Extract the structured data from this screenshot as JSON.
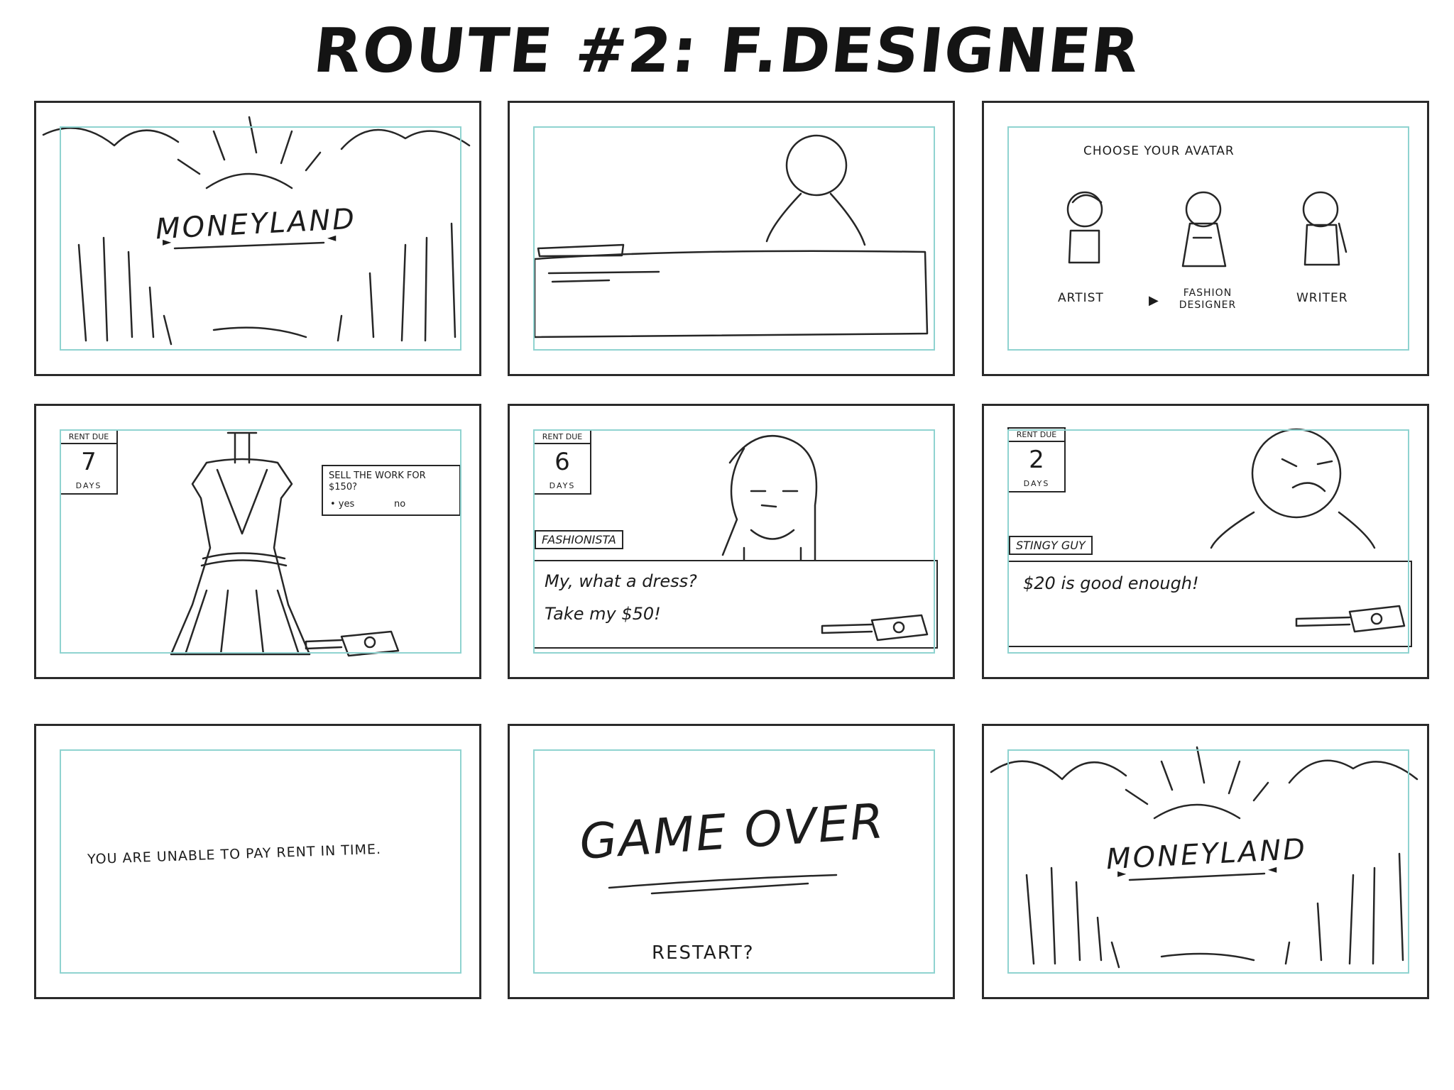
{
  "title": "ROUTE #2: F.DESIGNER",
  "panels": {
    "p1": {
      "logo": "MONEYLAND"
    },
    "p3": {
      "heading": "CHOOSE YOUR AVATAR",
      "options": [
        "ARTIST",
        "FASHION DESIGNER",
        "WRITER"
      ]
    },
    "p4": {
      "rent_label": "RENT DUE",
      "days_num": "7",
      "days_label": "DAYS",
      "prompt": "SELL THE WORK FOR $150?",
      "yes": "• yes",
      "no": "no"
    },
    "p5": {
      "rent_label": "RENT DUE",
      "days_num": "6",
      "days_label": "DAYS",
      "speaker": "FASHIONISTA",
      "line1": "My, what a dress?",
      "line2": "Take my $50!"
    },
    "p6": {
      "rent_label": "RENT DUE",
      "days_num": "2",
      "days_label": "DAYS",
      "speaker": "STINGY GUY",
      "line1": "$20 is good enough!"
    },
    "p7": {
      "message": "YOU ARE UNABLE TO PAY RENT IN TIME."
    },
    "p8": {
      "headline": "GAME OVER",
      "restart": "RESTART?"
    },
    "p9": {
      "logo": "MONEYLAND"
    }
  },
  "colors": {
    "safe_area": "#8fd3d0",
    "pencil": "#262626"
  }
}
